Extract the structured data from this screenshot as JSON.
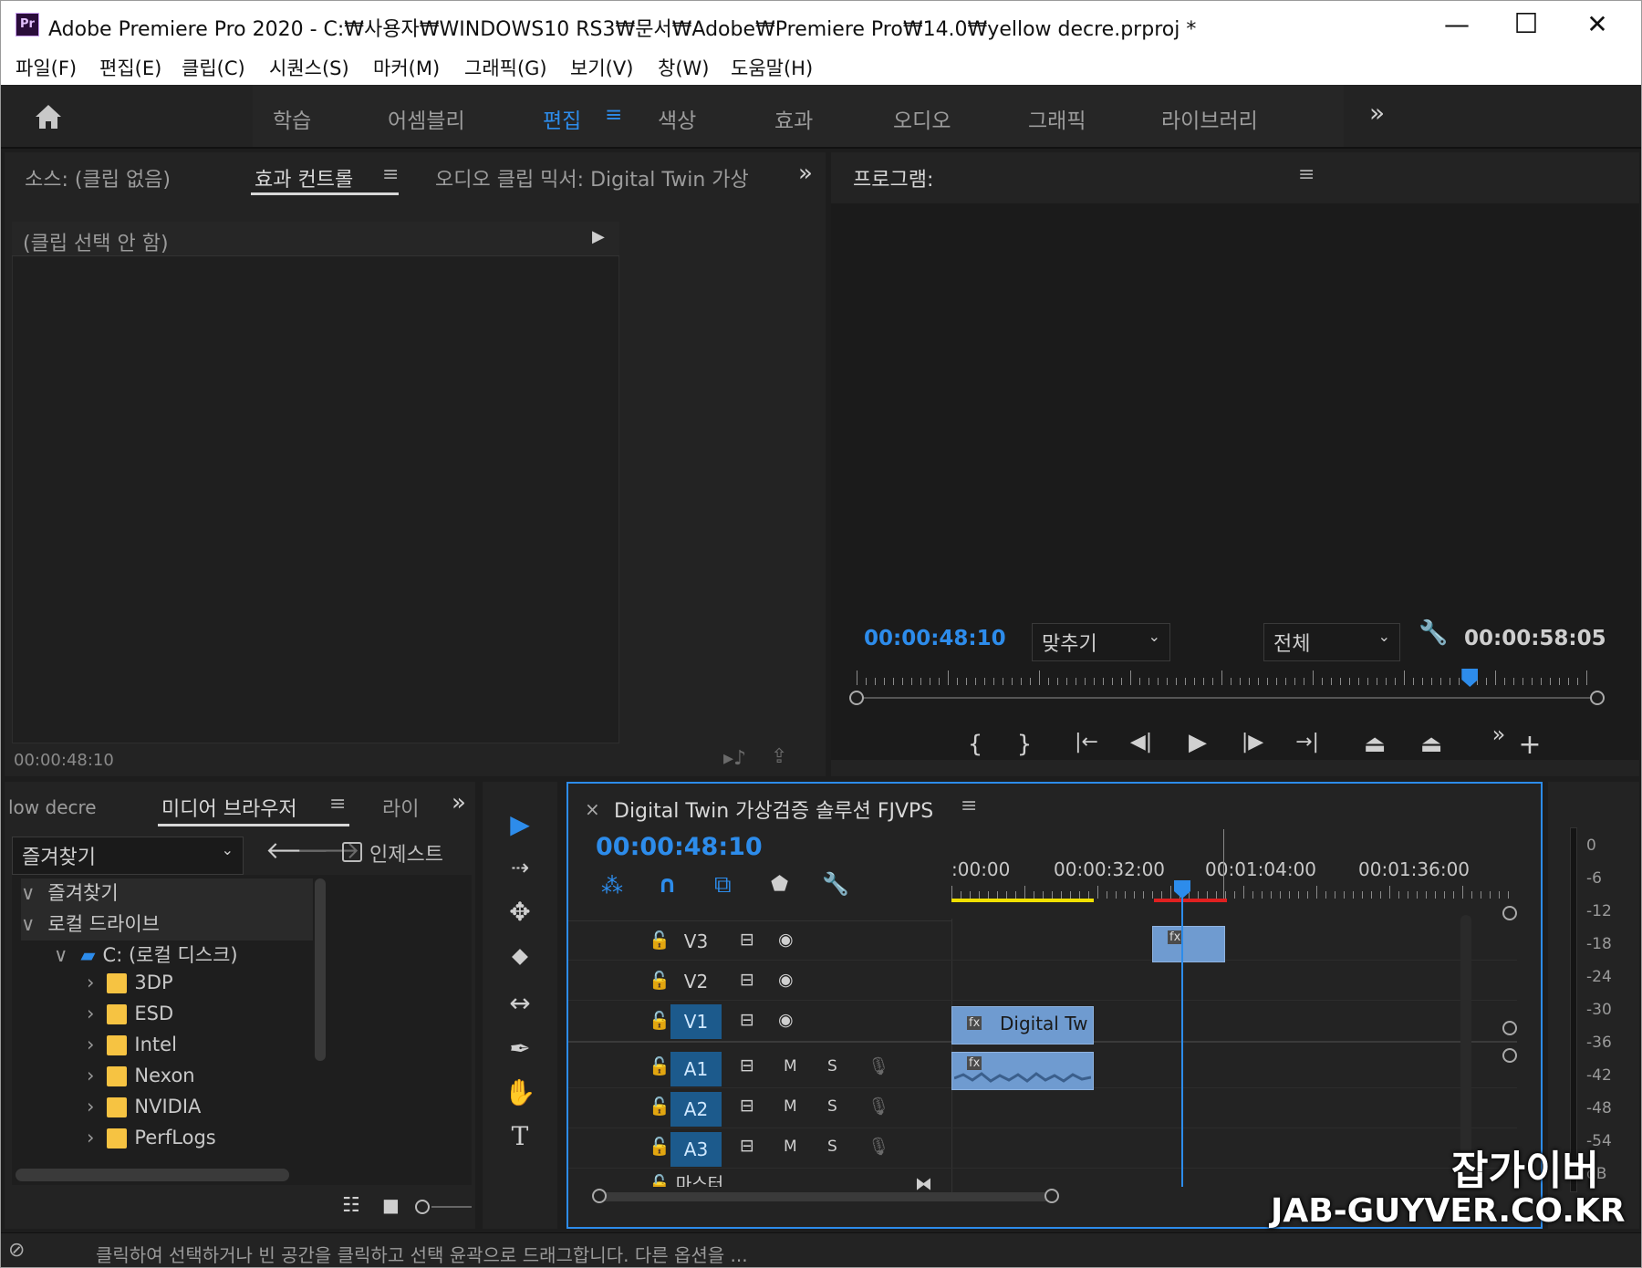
{
  "window": {
    "title": "Adobe Premiere Pro 2020 - C:₩사용자₩WINDOWS10 RS3₩문서₩Adobe₩Premiere Pro₩14.0₩yellow decre.prproj *",
    "app_badge": "Pr",
    "minimize": "—",
    "maximize": "☐",
    "close": "✕"
  },
  "menu": [
    "파일(F)",
    "편집(E)",
    "클립(C)",
    "시퀀스(S)",
    "마커(M)",
    "그래픽(G)",
    "보기(V)",
    "창(W)",
    "도움말(H)"
  ],
  "workspaces": {
    "tabs": [
      "학습",
      "어셈블리",
      "편집",
      "색상",
      "효과",
      "오디오",
      "그래픽",
      "라이브러리"
    ],
    "active": "편집",
    "menu_icon": "≡",
    "more": "»"
  },
  "source_panel": {
    "tabs": [
      "소스: (클립 없음)",
      "효과 컨트롤",
      "오디오 클립 믹서: Digital Twin 가상"
    ],
    "active_tab": "효과 컨트롤",
    "menu_icon": "≡",
    "more": "»",
    "no_clip": "(클립 선택 안 함)",
    "timecode": "00:00:48:10"
  },
  "program_panel": {
    "title": "프로그램:",
    "menu_icon": "≡",
    "timecode": "00:00:48:10",
    "fit": "맞추기",
    "quality": "전체",
    "duration": "00:00:58:05",
    "playhead_fraction": 0.83,
    "controls": [
      "{",
      "}",
      "|←",
      "◀|",
      "▶",
      "|▶",
      "→|",
      "⏏",
      "⏏"
    ],
    "more": "»",
    "add": "+"
  },
  "project_panel": {
    "tab_partial": "low decre",
    "tab_active": "미디어 브라우저",
    "tab_next": "라이",
    "menu_icon": "≡",
    "more": "»",
    "favorites_dropdown": "즐겨찾기",
    "ingest_label": "인제스트",
    "tree": [
      {
        "label": "즐겨찾기",
        "level": 0,
        "arrow": "∨"
      },
      {
        "label": "로컬 드라이브",
        "level": 0,
        "arrow": "∨"
      },
      {
        "label": "C: (로컬 디스크)",
        "level": 1,
        "arrow": "∨"
      },
      {
        "label": "3DP",
        "level": 2,
        "arrow": "›"
      },
      {
        "label": "ESD",
        "level": 2,
        "arrow": "›"
      },
      {
        "label": "Intel",
        "level": 2,
        "arrow": "›"
      },
      {
        "label": "Nexon",
        "level": 2,
        "arrow": "›"
      },
      {
        "label": "NVIDIA",
        "level": 2,
        "arrow": "›"
      },
      {
        "label": "PerfLogs",
        "level": 2,
        "arrow": "›"
      }
    ]
  },
  "timeline": {
    "close": "×",
    "sequence_name": "Digital Twin 가상검증 솔루션 FJVPS",
    "menu_icon": "≡",
    "timecode": "00:00:48:10",
    "ruler_labels": [
      ":00:00",
      "00:00:32:00",
      "00:01:04:00",
      "00:01:36:00"
    ],
    "video_tracks": [
      "V3",
      "V2",
      "V1"
    ],
    "audio_tracks": [
      "A1",
      "A2",
      "A3"
    ],
    "mute": "M",
    "solo": "S",
    "clip_v1": "Digital Tw",
    "master_partial": "마스터"
  },
  "tools": [
    "▶",
    "⇢",
    "✥",
    "⬥",
    "↔",
    "✒",
    "✋",
    "T"
  ],
  "audio_meter": [
    "0",
    "-6",
    "-12",
    "-18",
    "-24",
    "-30",
    "-36",
    "-42",
    "-48",
    "-54",
    "dB"
  ],
  "status": {
    "text": "클릭하여 선택하거나 빈 공간을 클릭하고 선택 윤곽으로 드래그합니다. 다른 옵션을 ..."
  },
  "watermark": {
    "line1": "잡가이버",
    "line2": "JAB-GUYVER.CO.KR"
  },
  "colors": {
    "accent": "#2d8ceb",
    "clip": "#6f9bd0",
    "track_active": "#1c5a8c",
    "work_area": "#f0e000",
    "render_bar": "#e02020"
  }
}
